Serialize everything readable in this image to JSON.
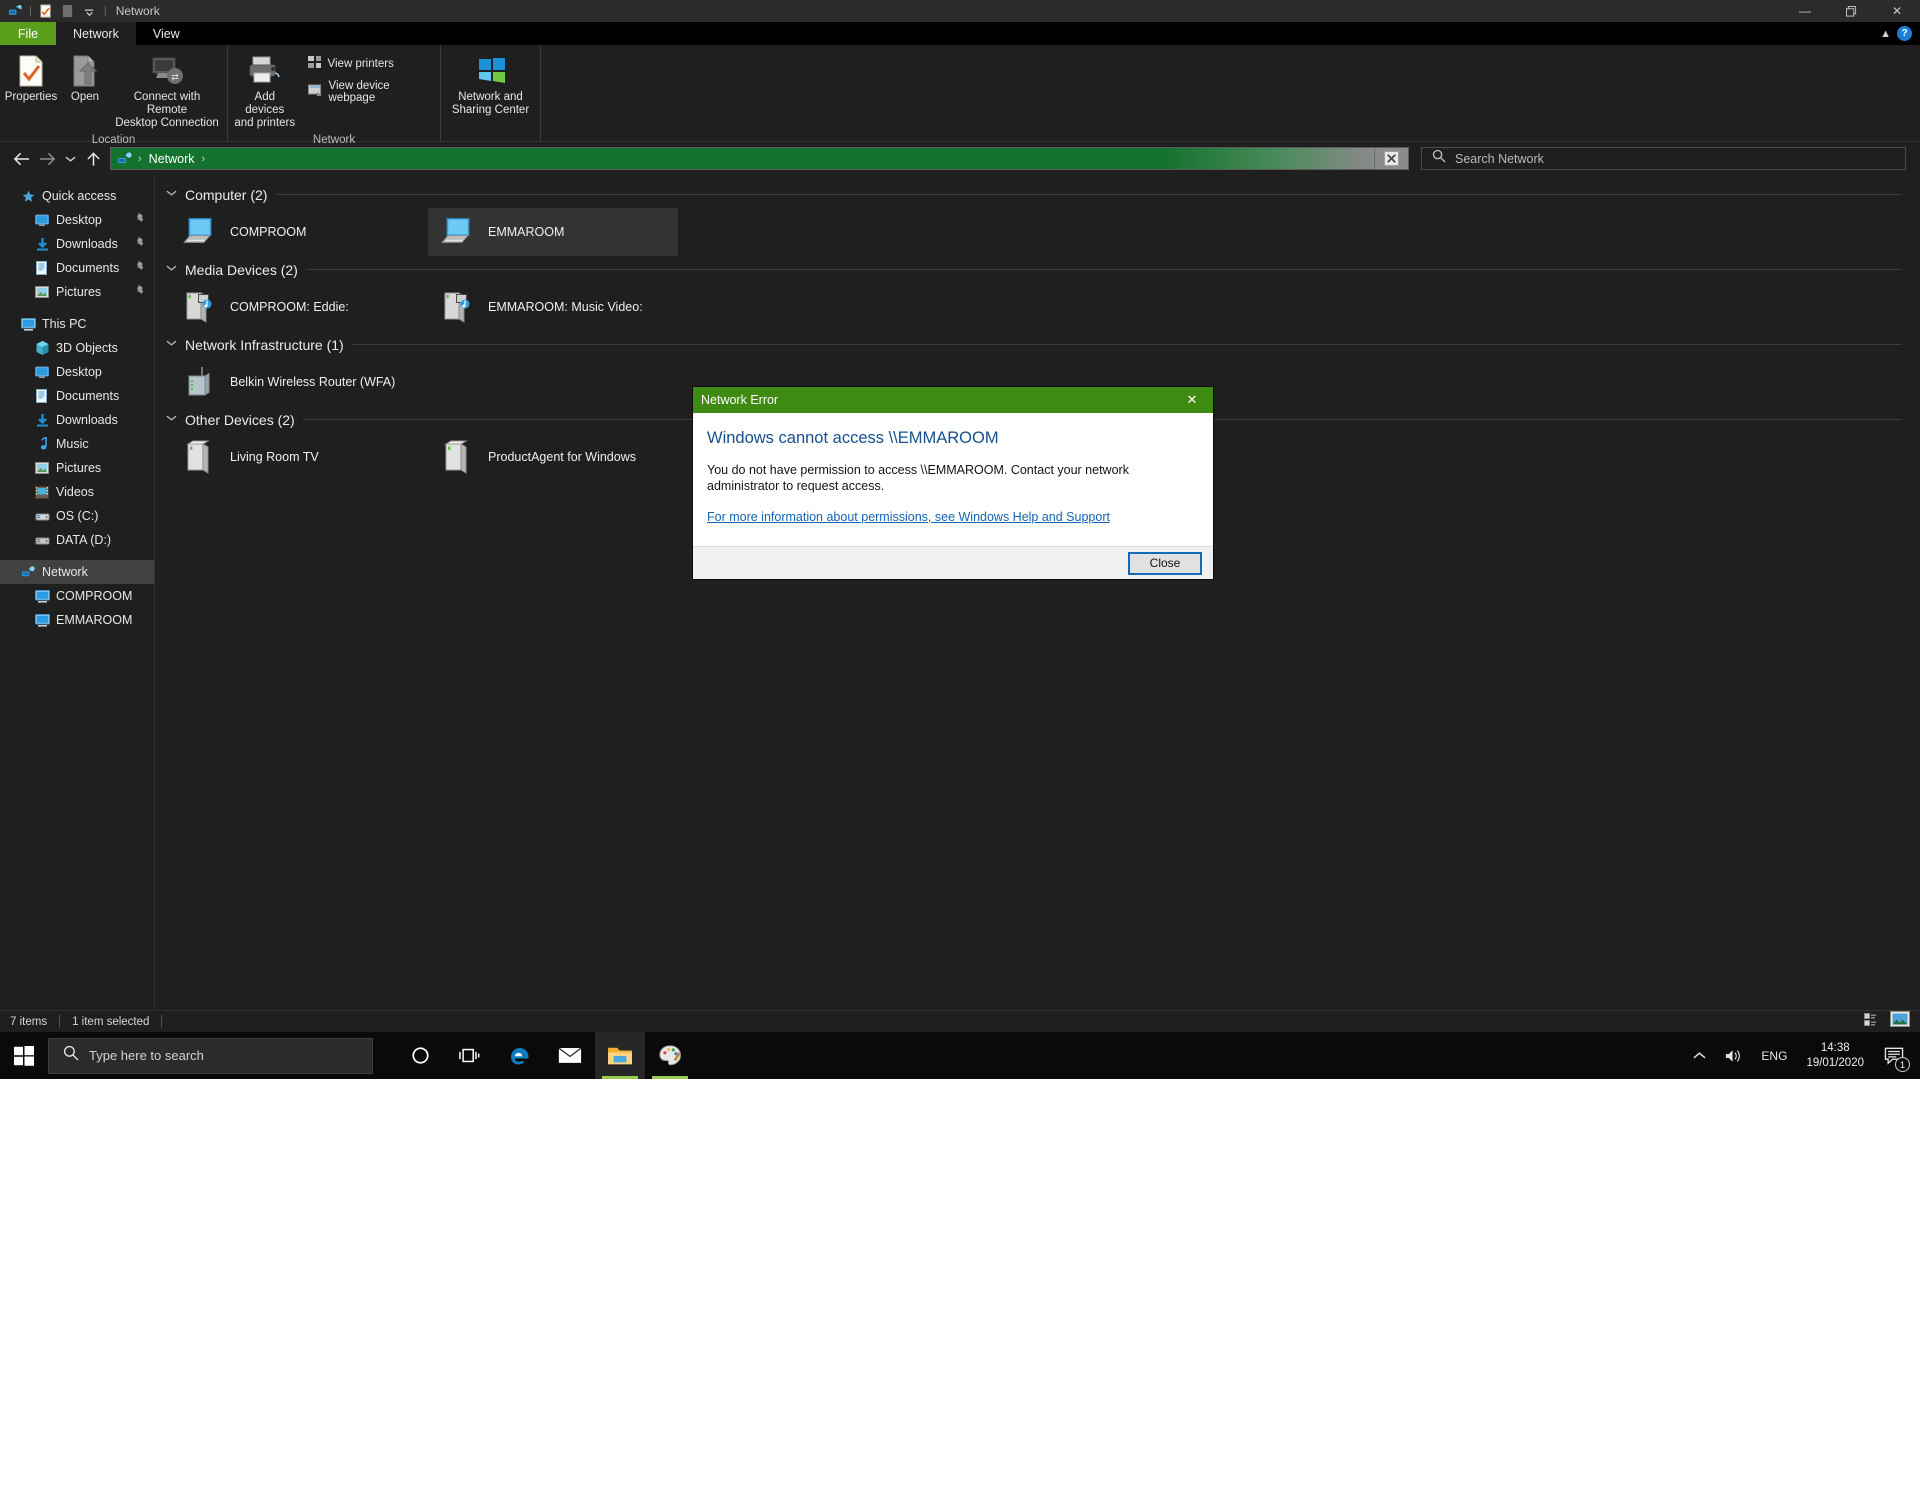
{
  "window": {
    "title": "Network",
    "quick_access": [
      "network-icon",
      "properties-icon",
      "blank-icon",
      "dropdown-icon"
    ],
    "controls": {
      "minimize": "—",
      "maximize": "❐",
      "close": "✕"
    }
  },
  "ribbon": {
    "tabs": [
      {
        "label": "File",
        "type": "file"
      },
      {
        "label": "Network",
        "type": "active"
      },
      {
        "label": "View",
        "type": "normal"
      }
    ],
    "collapse_icon": "chevron-up-icon",
    "help_icon": "help-icon",
    "groups": [
      {
        "label": "Location",
        "buttons": [
          {
            "label": "Properties",
            "icon": "properties-icon"
          },
          {
            "label": "Open",
            "icon": "open-icon"
          },
          {
            "label": "Connect with Remote\nDesktop Connection",
            "icon": "remote-desktop-icon"
          }
        ]
      },
      {
        "label": "Network",
        "buttons": [
          {
            "label": "Add devices\nand printers",
            "icon": "add-printer-icon"
          }
        ],
        "small_buttons": [
          {
            "label": "View printers",
            "icon": "printers-icon"
          },
          {
            "label": "View device webpage",
            "icon": "webpage-icon"
          }
        ]
      },
      {
        "label": "",
        "buttons": [
          {
            "label": "Network and\nSharing Center",
            "icon": "sharing-center-icon"
          }
        ]
      }
    ]
  },
  "navigation": {
    "back_icon": "arrow-left-icon",
    "forward_icon": "arrow-right-icon",
    "recent_icon": "chevron-down-icon",
    "up_icon": "arrow-up-icon",
    "breadcrumb": {
      "icon": "network-icon",
      "items": [
        "Network"
      ]
    },
    "clear_icon": "clear-icon"
  },
  "search": {
    "placeholder": "Search Network",
    "value": "",
    "icon": "search-icon"
  },
  "sidebar": {
    "items": [
      {
        "label": "Quick access",
        "icon": "star-icon",
        "level": 0,
        "pin": false,
        "selected": false
      },
      {
        "label": "Desktop",
        "icon": "desktop-icon",
        "level": 1,
        "pin": true,
        "selected": false
      },
      {
        "label": "Downloads",
        "icon": "downloads-icon",
        "level": 1,
        "pin": true,
        "selected": false
      },
      {
        "label": "Documents",
        "icon": "documents-icon",
        "level": 1,
        "pin": true,
        "selected": false
      },
      {
        "label": "Pictures",
        "icon": "pictures-icon",
        "level": 1,
        "pin": true,
        "selected": false
      },
      {
        "label": "This PC",
        "icon": "thispc-icon",
        "level": 0,
        "pin": false,
        "selected": false,
        "gap_before": true
      },
      {
        "label": "3D Objects",
        "icon": "cube-icon",
        "level": 1,
        "pin": false,
        "selected": false
      },
      {
        "label": "Desktop",
        "icon": "desktop-icon",
        "level": 1,
        "pin": false,
        "selected": false
      },
      {
        "label": "Documents",
        "icon": "documents-icon",
        "level": 1,
        "pin": false,
        "selected": false
      },
      {
        "label": "Downloads",
        "icon": "downloads-icon",
        "level": 1,
        "pin": false,
        "selected": false
      },
      {
        "label": "Music",
        "icon": "music-icon",
        "level": 1,
        "pin": false,
        "selected": false
      },
      {
        "label": "Pictures",
        "icon": "pictures-icon",
        "level": 1,
        "pin": false,
        "selected": false
      },
      {
        "label": "Videos",
        "icon": "videos-icon",
        "level": 1,
        "pin": false,
        "selected": false
      },
      {
        "label": "OS (C:)",
        "icon": "drive-icon",
        "level": 1,
        "pin": false,
        "selected": false
      },
      {
        "label": "DATA (D:)",
        "icon": "drive-icon",
        "level": 1,
        "pin": false,
        "selected": false
      },
      {
        "label": "Network",
        "icon": "network-icon",
        "level": 0,
        "pin": false,
        "selected": true,
        "gap_before": true
      },
      {
        "label": "COMPROOM",
        "icon": "computer-icon",
        "level": 1,
        "pin": false,
        "selected": false
      },
      {
        "label": "EMMAROOM",
        "icon": "computer-icon",
        "level": 1,
        "pin": false,
        "selected": false
      }
    ]
  },
  "content": {
    "groups": [
      {
        "title": "Computer (2)",
        "items": [
          {
            "label": "COMPROOM",
            "icon": "computer-icon",
            "selected": false
          },
          {
            "label": "EMMAROOM",
            "icon": "computer-icon",
            "selected": true
          }
        ]
      },
      {
        "title": "Media Devices (2)",
        "items": [
          {
            "label": "COMPROOM: Eddie:",
            "icon": "media-device-icon",
            "selected": false
          },
          {
            "label": "EMMAROOM: Music Video:",
            "icon": "media-device-icon",
            "selected": false
          }
        ]
      },
      {
        "title": "Network Infrastructure (1)",
        "items": [
          {
            "label": "Belkin Wireless Router (WFA)",
            "icon": "router-icon",
            "selected": false
          }
        ]
      },
      {
        "title": "Other Devices (2)",
        "items": [
          {
            "label": "Living Room TV",
            "icon": "device-icon",
            "selected": false
          },
          {
            "label": "ProductAgent for Windows",
            "icon": "device-icon",
            "selected": false
          }
        ]
      }
    ]
  },
  "statusbar": {
    "item_count": "7 items",
    "selection": "1 item selected",
    "details_view_icon": "details-view-icon",
    "large_icons_view_icon": "large-icons-view-icon"
  },
  "dialog": {
    "title": "Network Error",
    "close_icon": "close-icon",
    "heading": "Windows cannot access \\\\EMMAROOM",
    "body": "You do not have permission to access \\\\EMMAROOM. Contact your network administrator to request access.",
    "link": "For more information about permissions, see Windows Help and Support",
    "button": "Close"
  },
  "taskbar": {
    "start_icon": "windows-start-icon",
    "search_placeholder": "Type here to search",
    "search_icon": "search-icon",
    "icons": [
      {
        "name": "cortana-icon",
        "state": "none"
      },
      {
        "name": "task-view-icon",
        "state": "none"
      },
      {
        "name": "edge-icon",
        "state": "none"
      },
      {
        "name": "mail-icon",
        "state": "none"
      },
      {
        "name": "file-explorer-icon",
        "state": "active"
      },
      {
        "name": "paint-icon",
        "state": "running"
      }
    ],
    "tray": {
      "expand_icon": "chevron-up-icon",
      "volume_icon": "volume-icon",
      "language": "ENG",
      "time": "14:38",
      "date": "19/01/2020",
      "action_center_icon": "action-center-icon",
      "notification_count": "1"
    }
  },
  "colors": {
    "accent_green": "#5a9e1b",
    "address_green": "#14722e",
    "dialog_green": "#3f8a12",
    "link_blue": "#1464b4",
    "heading_blue": "#15508c",
    "taskbar_bg": "#0a0a0a",
    "window_bg": "#1f1f1f"
  }
}
